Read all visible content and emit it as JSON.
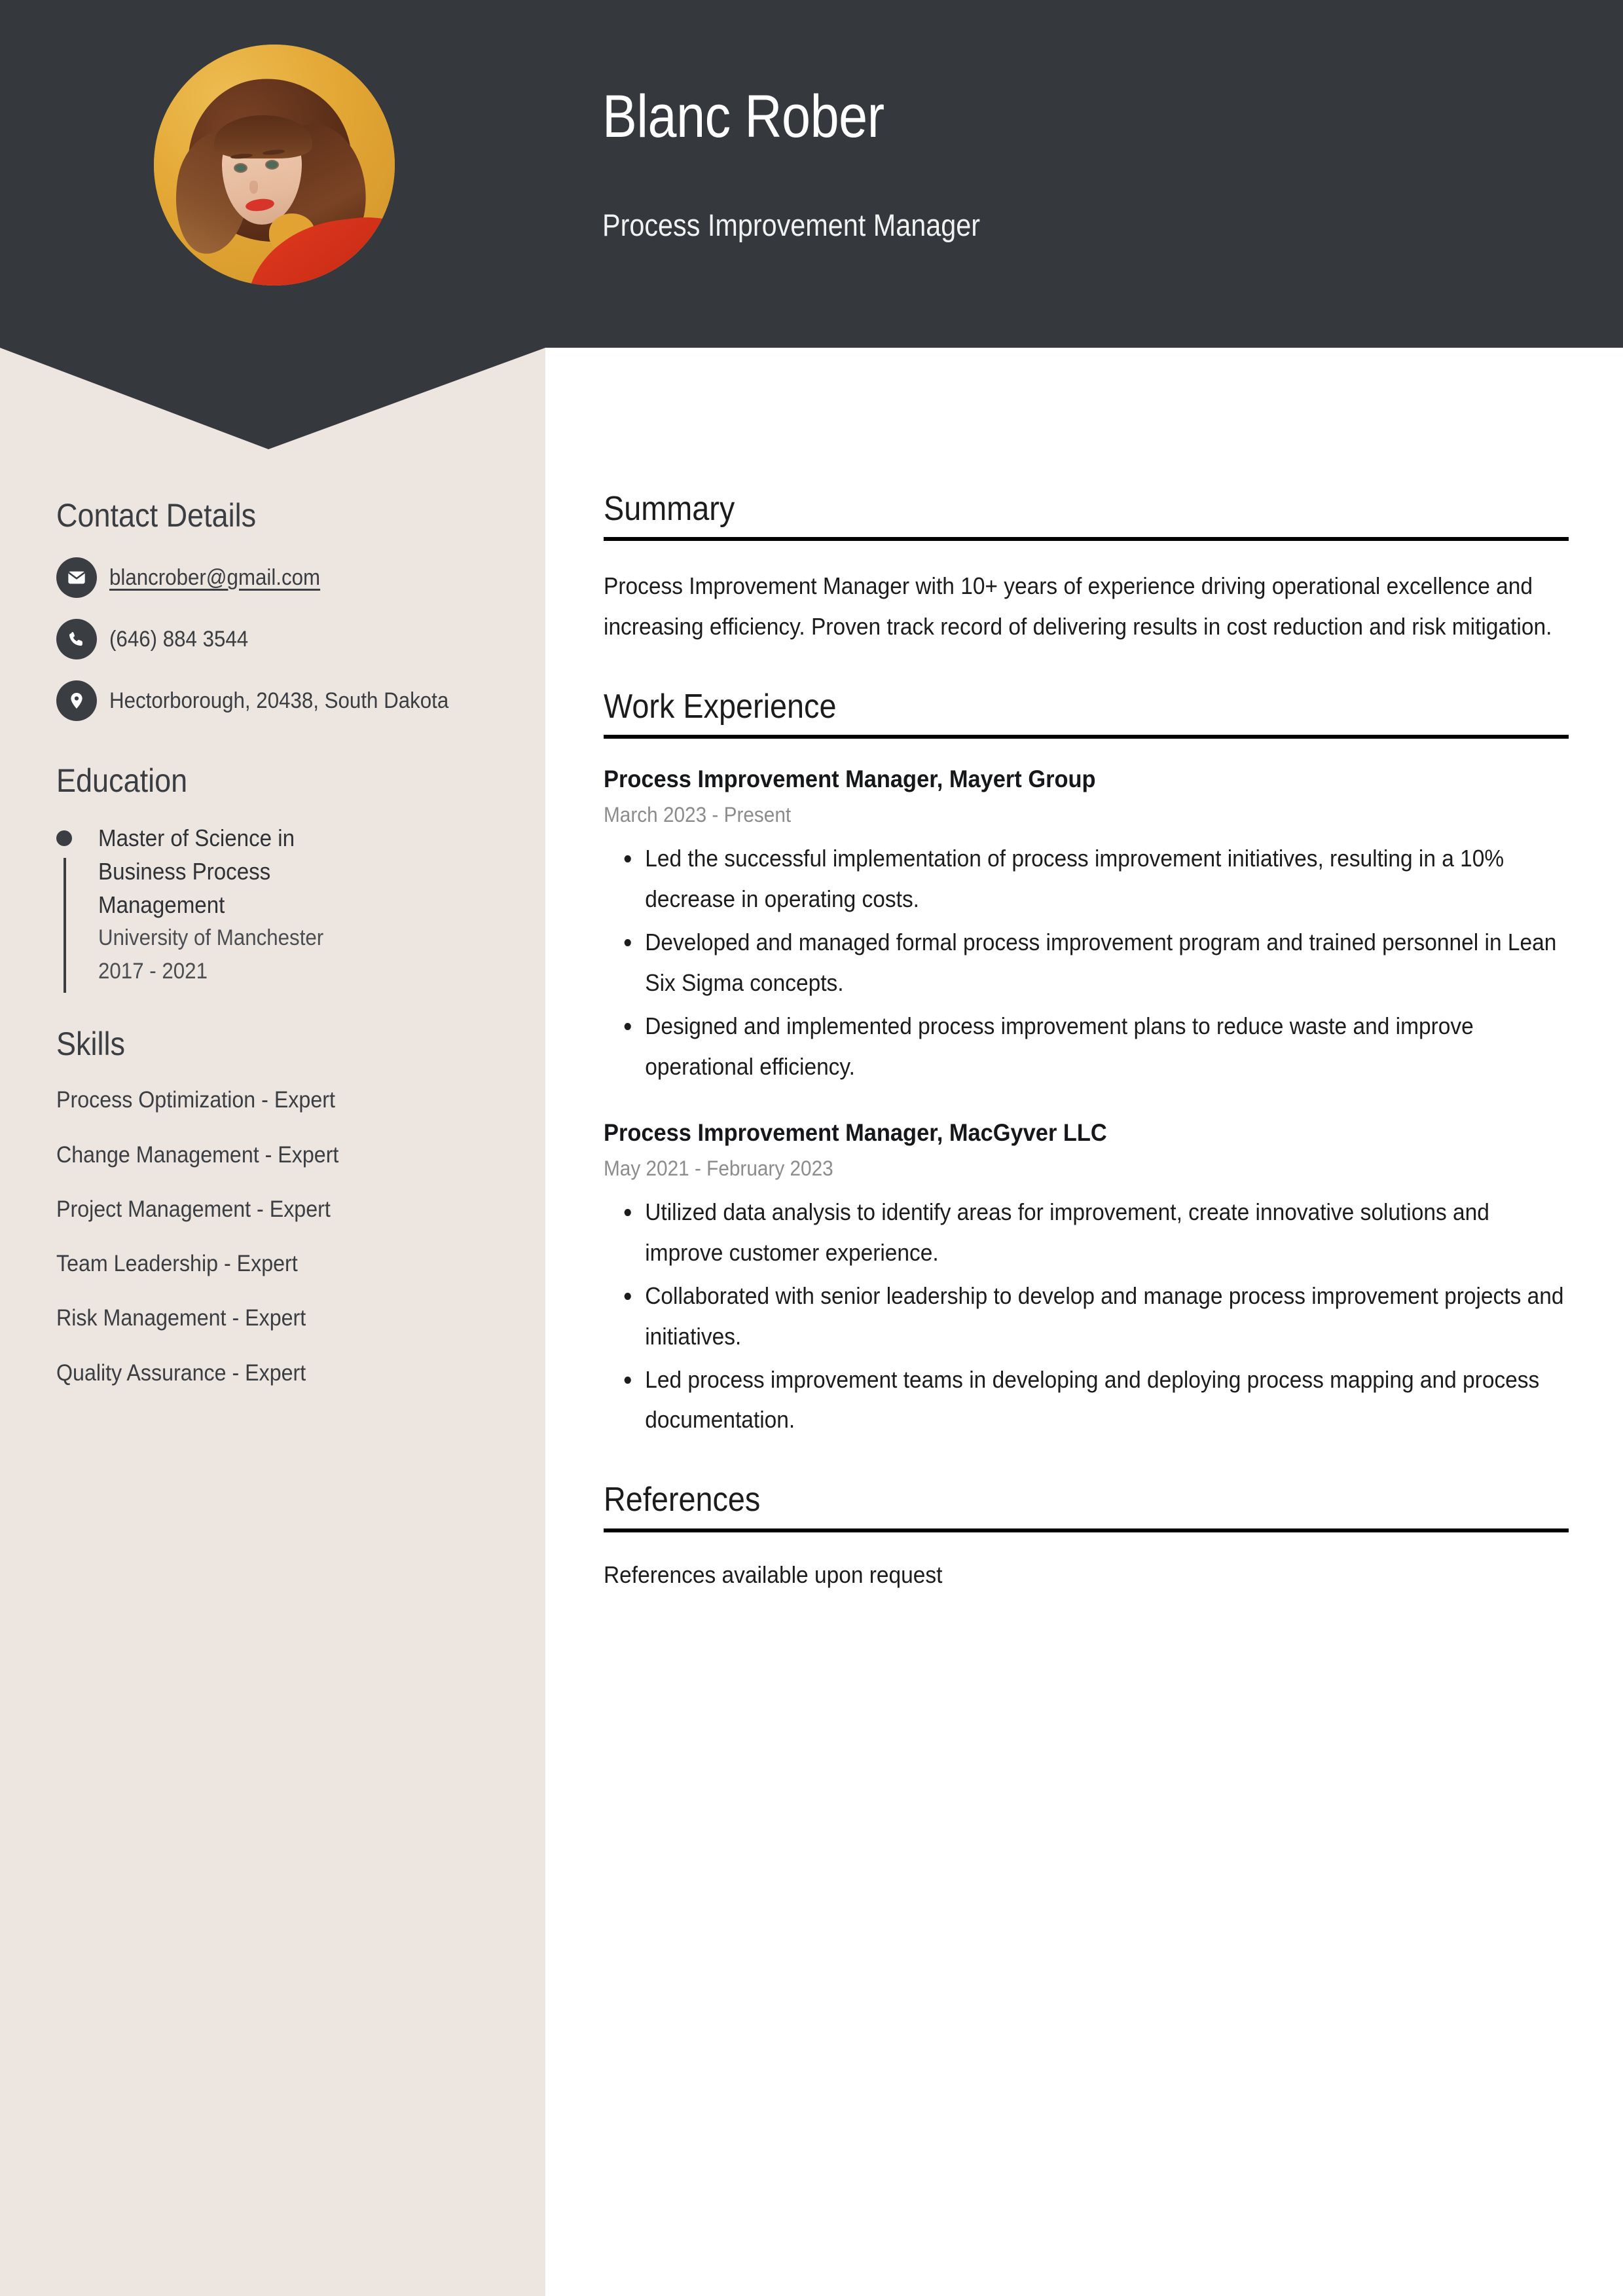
{
  "colors": {
    "header_bg": "#35383d",
    "sidebar_bg": "#ede5e0",
    "main_bg": "#ffffff",
    "accent_dark": "#3a3d42",
    "rule": "#000000",
    "muted_text": "#8c8c8c",
    "avatar_bg": "#e0a631",
    "avatar_garment": "#d8301a"
  },
  "header": {
    "name": "Blanc Rober",
    "job_title": "Process Improvement Manager",
    "avatar_alt": "Portrait photo of a woman with curly auburn hair wearing a red top on a golden background"
  },
  "sidebar": {
    "contact": {
      "heading": "Contact Details",
      "items": [
        {
          "icon": "envelope-icon",
          "value": "blancrober@gmail.com",
          "is_link": true
        },
        {
          "icon": "phone-icon",
          "value": "(646) 884 3544",
          "is_link": false
        },
        {
          "icon": "location-pin-icon",
          "value": "Hectorborough, 20438, South Dakota",
          "is_link": false
        }
      ]
    },
    "education": {
      "heading": "Education",
      "entries": [
        {
          "degree": "Master of Science in Business Process Management",
          "school": "University of Manchester",
          "years": "2017 - 2021"
        }
      ]
    },
    "skills": {
      "heading": "Skills",
      "items": [
        "Process Optimization - Expert",
        "Change Management - Expert",
        "Project Management - Expert",
        "Team Leadership - Expert",
        "Risk Management - Expert",
        "Quality Assurance - Expert"
      ]
    }
  },
  "main": {
    "summary": {
      "heading": "Summary",
      "text": "Process Improvement Manager with 10+ years of experience driving operational excellence and increasing efficiency. Proven track record of delivering results in cost reduction and risk mitigation."
    },
    "work_experience": {
      "heading": "Work Experience",
      "jobs": [
        {
          "title": "Process Improvement Manager, Mayert Group",
          "dates": "March 2023 - Present",
          "bullets": [
            "Led the successful implementation of process improvement initiatives, resulting in a 10% decrease in operating costs.",
            "Developed and managed formal process improvement program and trained personnel in Lean Six Sigma concepts.",
            "Designed and implemented process improvement plans to reduce waste and improve operational efficiency."
          ]
        },
        {
          "title": "Process Improvement Manager, MacGyver LLC",
          "dates": "May 2021 - February 2023",
          "bullets": [
            "Utilized data analysis to identify areas for improvement, create innovative solutions and improve customer experience.",
            "Collaborated with senior leadership to develop and manage process improvement projects and initiatives.",
            "Led process improvement teams in developing and deploying process mapping and process documentation."
          ]
        }
      ]
    },
    "references": {
      "heading": "References",
      "text": "References available upon request"
    }
  }
}
